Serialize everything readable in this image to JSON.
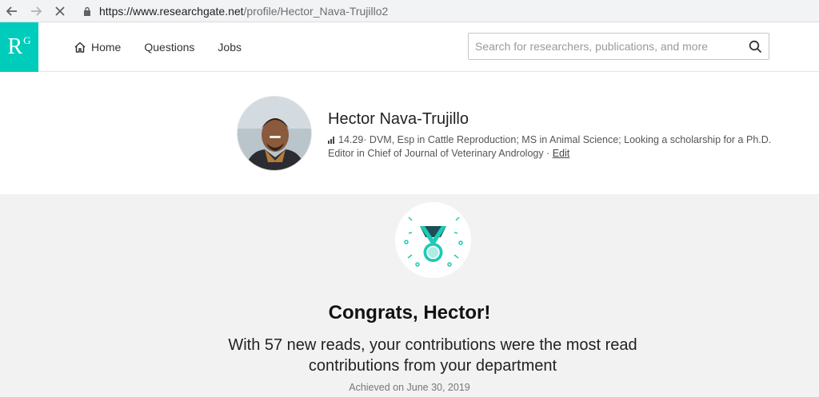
{
  "browser": {
    "url_domain": "https://www.researchgate.net",
    "url_path": "/profile/Hector_Nava-Trujillo2"
  },
  "header": {
    "logo_main": "R",
    "logo_sup": "G",
    "nav": [
      {
        "label": "Home",
        "icon": "home-icon"
      },
      {
        "label": "Questions"
      },
      {
        "label": "Jobs"
      }
    ],
    "search_placeholder": "Search for researchers, publications, and more"
  },
  "profile": {
    "name": "Hector Nava-Trujillo",
    "score": "14.29",
    "line1_text": " · DVM, Esp in Cattle Reproduction; MS in Animal Science; Looking a scholarship for a Ph.D.",
    "line2_text": "Editor in Chief of Journal of Veterinary Andrology · ",
    "edit_label": "Edit"
  },
  "achievement": {
    "title": "Congrats, Hector!",
    "message": "With 57 new reads, your contributions were the most read contributions from your department",
    "achieved": "Achieved on June 30, 2019",
    "colors": {
      "teal": "#1fc9b5",
      "dark": "#1d4e57"
    }
  }
}
